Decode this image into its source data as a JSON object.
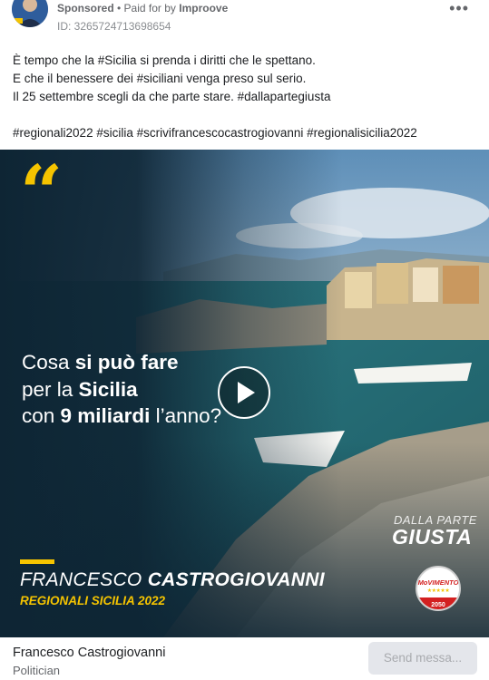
{
  "header": {
    "sponsored_label": "Sponsored",
    "separator": " • ",
    "paid_for_prefix": "Paid for by ",
    "payer": "Improove",
    "ad_id": "ID: 3265724713698654"
  },
  "body": {
    "lines": [
      "È tempo che la #Sicilia si prenda i diritti che le spettano.",
      "E che il benessere dei #siciliani venga preso sul serio.",
      "Il 25 settembre scegli da che parte stare. #dallapartegiusta"
    ],
    "hashtags": "#regionali2022 #sicilia #scrivifrancescocastrogiovanni #regionalisicilia2022"
  },
  "media": {
    "headline": {
      "line1_plain": "Cosa ",
      "line1_bold": "si può fare",
      "line2_plain": "per la ",
      "line2_bold": "Sicilia",
      "line3_plain": "con ",
      "line3_bold": "9 miliardi",
      "line3_tail": " l’anno?"
    },
    "candidate_first": "FRANCESCO ",
    "candidate_last": "CASTROGIOVANNI",
    "candidate_sub": "REGIONALI SICILIA 2022",
    "brand_top": "DALLA PARTE",
    "brand_main": "GIUSTA",
    "logo_text": "MoVIMENTO",
    "logo_stars": "★★★★★",
    "logo_year": "2050",
    "play_icon": "play-icon",
    "colors": {
      "accent_yellow": "#f5c400",
      "logo_red": "#d32020"
    }
  },
  "footer": {
    "page_name": "Francesco Castrogiovanni",
    "page_category": "Politician",
    "send_button": "Send messa..."
  }
}
